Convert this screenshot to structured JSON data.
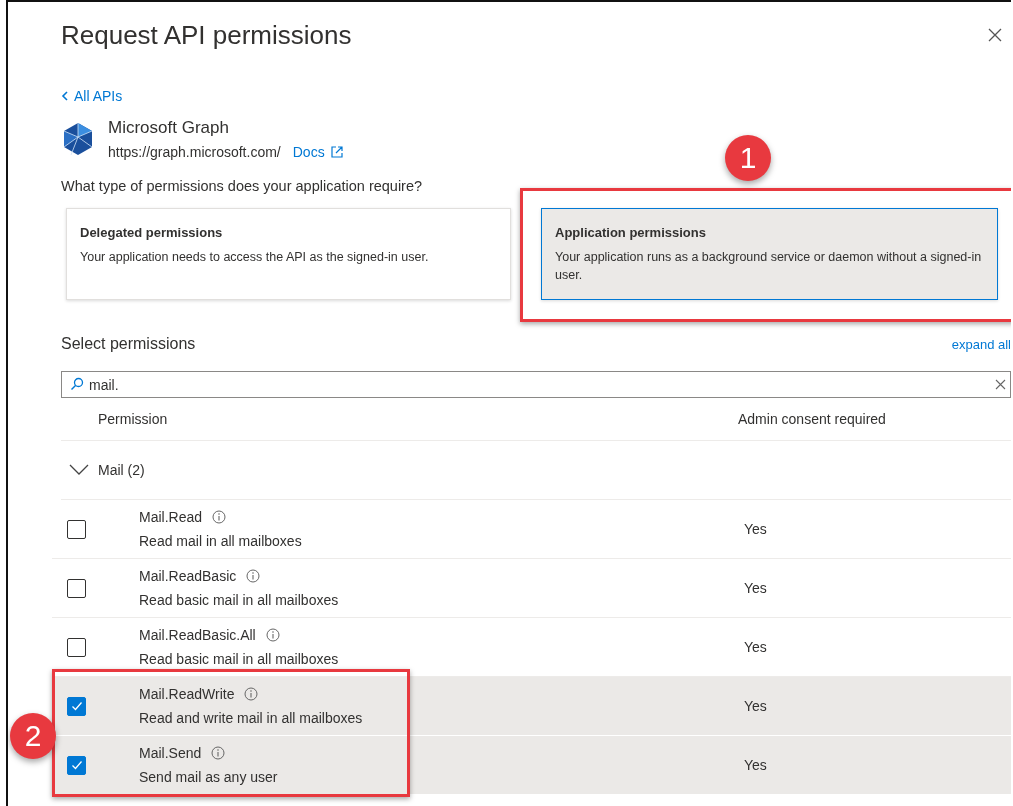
{
  "panel": {
    "title": "Request API permissions",
    "back_link": "All APIs"
  },
  "api": {
    "name": "Microsoft Graph",
    "url": "https://graph.microsoft.com/",
    "docs_link": "Docs"
  },
  "question": "What type of permissions does your application require?",
  "permission_types": [
    {
      "title": "Delegated permissions",
      "description": "Your application needs to access the API as the signed-in user.",
      "selected": false
    },
    {
      "title": "Application permissions",
      "description": "Your application runs as a background service or daemon without a signed-in user.",
      "selected": true
    }
  ],
  "select_heading": "Select permissions",
  "expand_all": "expand all",
  "search": {
    "value": "mail."
  },
  "table": {
    "columns": [
      "Permission",
      "Admin consent required"
    ],
    "group": {
      "label": "Mail (2)",
      "expanded": true
    },
    "rows": [
      {
        "name": "Mail.Read",
        "description": "Read mail in all mailboxes",
        "admin_consent": "Yes",
        "checked": false
      },
      {
        "name": "Mail.ReadBasic",
        "description": "Read basic mail in all mailboxes",
        "admin_consent": "Yes",
        "checked": false
      },
      {
        "name": "Mail.ReadBasic.All",
        "description": "Read basic mail in all mailboxes",
        "admin_consent": "Yes",
        "checked": false
      },
      {
        "name": "Mail.ReadWrite",
        "description": "Read and write mail in all mailboxes",
        "admin_consent": "Yes",
        "checked": true
      },
      {
        "name": "Mail.Send",
        "description": "Send mail as any user",
        "admin_consent": "Yes",
        "checked": true
      }
    ]
  },
  "annotations": [
    {
      "number": "1"
    },
    {
      "number": "2"
    }
  ]
}
